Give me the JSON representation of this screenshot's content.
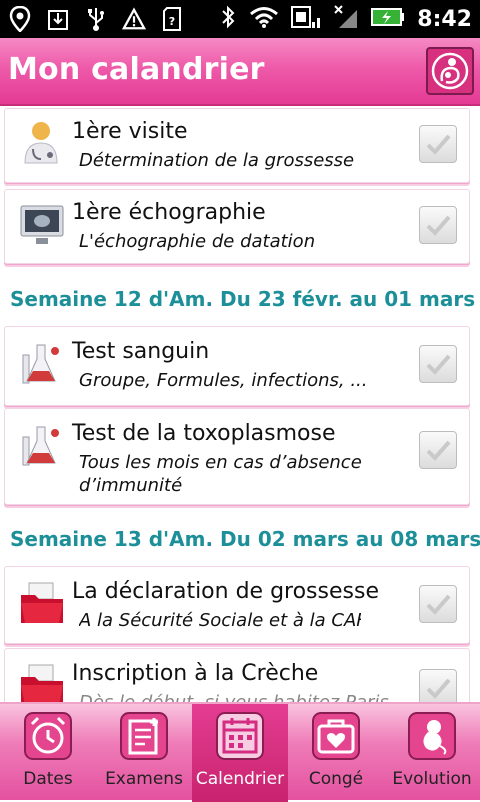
{
  "status": {
    "time": "8:42"
  },
  "header": {
    "title": "Mon calandrier"
  },
  "list": {
    "items": [
      {
        "title": "1ère visite",
        "desc": "Détermination de la grossesse",
        "icon": "doctor-icon"
      },
      {
        "title": "1ère échographie",
        "desc": "L'échographie de datation",
        "icon": "ultrasound-icon"
      },
      {
        "section": "Semaine 12 d'Am. Du 23 févr. au 01 mars"
      },
      {
        "title": "Test sanguin",
        "desc": "Groupe, Formules, infections, ...",
        "icon": "lab-flask-icon"
      },
      {
        "title": "Test de la toxoplasmose",
        "desc": "Tous les mois en cas d’absence",
        "desc2": "d’immunité",
        "icon": "lab-flask-icon"
      },
      {
        "section": "Semaine 13 d'Am. Du 02 mars au 08 mars"
      },
      {
        "title": "La déclaration de grossesse",
        "desc": "A la Sécurité Sociale et à la CAF",
        "icon": "red-folder-icon"
      },
      {
        "title": "Inscription à la Crèche",
        "desc": "Dès le début, si vous habitez Paris",
        "icon": "red-folder-icon"
      }
    ]
  },
  "tabs": [
    {
      "label": "Dates",
      "icon": "alarm-clock-icon",
      "active": false
    },
    {
      "label": "Examens",
      "icon": "notepad-icon",
      "active": false
    },
    {
      "label": "Calendrier",
      "icon": "calendar-icon",
      "active": true
    },
    {
      "label": "Congé",
      "icon": "heart-bag-icon",
      "active": false
    },
    {
      "label": "Evolution",
      "icon": "fetus-icon",
      "active": false
    }
  ],
  "colors": {
    "accent": "#e43a94",
    "section": "#1c8f98"
  }
}
